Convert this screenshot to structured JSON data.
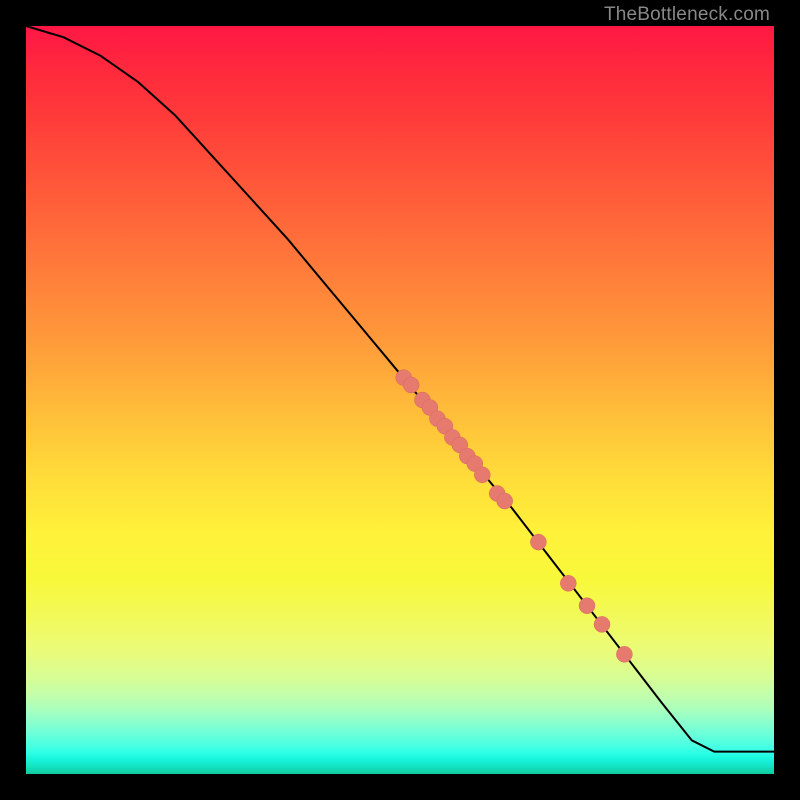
{
  "watermark": "TheBottleneck.com",
  "colors": {
    "dot_fill": "#e67a6e",
    "dot_stroke": "#d86a5e",
    "curve_stroke": "#000000",
    "frame": "#000000"
  },
  "chart_data": {
    "type": "line",
    "title": "",
    "xlabel": "",
    "ylabel": "",
    "xlim": [
      0,
      100
    ],
    "ylim": [
      0,
      100
    ],
    "grid": false,
    "curve_points": [
      {
        "x": 0.0,
        "y": 100.0
      },
      {
        "x": 5.0,
        "y": 98.5
      },
      {
        "x": 10.0,
        "y": 96.0
      },
      {
        "x": 15.0,
        "y": 92.5
      },
      {
        "x": 20.0,
        "y": 88.0
      },
      {
        "x": 25.0,
        "y": 82.5
      },
      {
        "x": 30.0,
        "y": 77.0
      },
      {
        "x": 35.0,
        "y": 71.5
      },
      {
        "x": 40.0,
        "y": 65.5
      },
      {
        "x": 45.0,
        "y": 59.5
      },
      {
        "x": 50.0,
        "y": 53.5
      },
      {
        "x": 55.0,
        "y": 47.5
      },
      {
        "x": 60.0,
        "y": 41.5
      },
      {
        "x": 65.0,
        "y": 35.5
      },
      {
        "x": 70.0,
        "y": 29.0
      },
      {
        "x": 75.0,
        "y": 22.5
      },
      {
        "x": 80.0,
        "y": 16.0
      },
      {
        "x": 85.0,
        "y": 9.5
      },
      {
        "x": 89.0,
        "y": 4.5
      },
      {
        "x": 92.0,
        "y": 3.0
      },
      {
        "x": 100.0,
        "y": 3.0
      }
    ],
    "series": [
      {
        "name": "points",
        "marker_radius": 8,
        "points": [
          {
            "x": 50.5,
            "y": 53.0
          },
          {
            "x": 51.5,
            "y": 52.0
          },
          {
            "x": 53.0,
            "y": 50.0
          },
          {
            "x": 54.0,
            "y": 49.0
          },
          {
            "x": 55.0,
            "y": 47.5
          },
          {
            "x": 56.0,
            "y": 46.5
          },
          {
            "x": 57.0,
            "y": 45.0
          },
          {
            "x": 58.0,
            "y": 44.0
          },
          {
            "x": 59.0,
            "y": 42.5
          },
          {
            "x": 60.0,
            "y": 41.5
          },
          {
            "x": 61.0,
            "y": 40.0
          },
          {
            "x": 63.0,
            "y": 37.5
          },
          {
            "x": 64.0,
            "y": 36.5
          },
          {
            "x": 68.5,
            "y": 31.0
          },
          {
            "x": 72.5,
            "y": 25.5
          },
          {
            "x": 75.0,
            "y": 22.5
          },
          {
            "x": 77.0,
            "y": 20.0
          },
          {
            "x": 80.0,
            "y": 16.0
          }
        ]
      }
    ]
  }
}
